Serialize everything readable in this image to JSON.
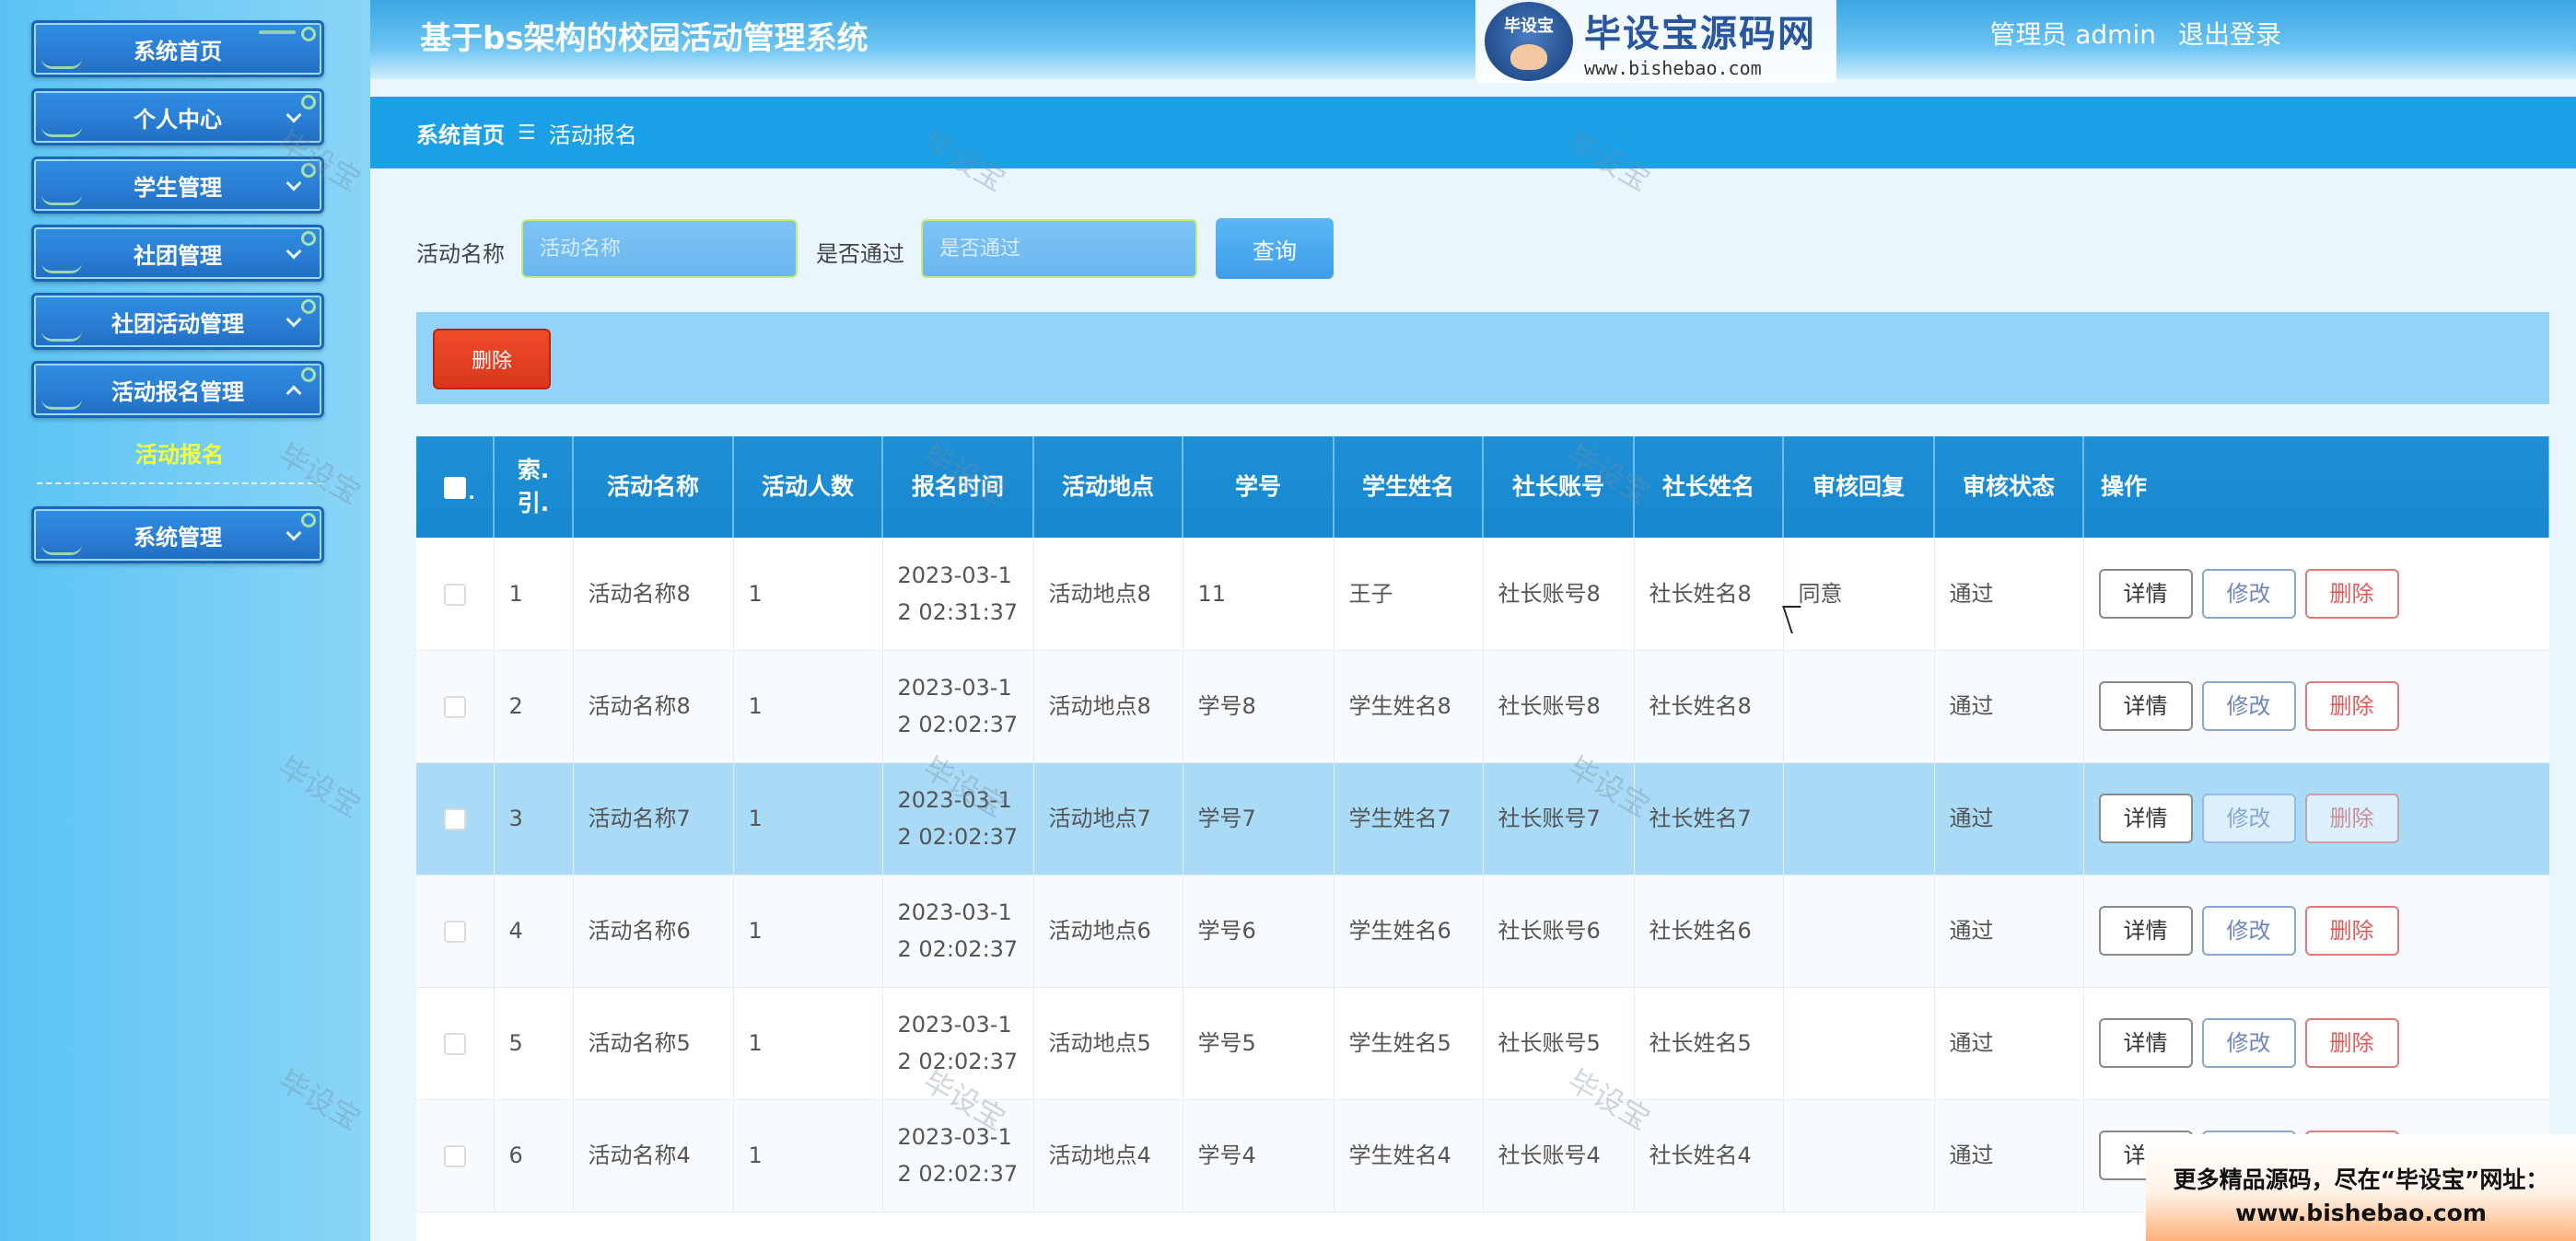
{
  "header": {
    "app_title": "基于bs架构的校园活动管理系统",
    "user_label": "管理员 admin",
    "logout": "退出登录",
    "logo_badge": "毕设宝",
    "logo_main": "毕设宝源码网",
    "logo_url": "www.bishebao.com"
  },
  "sidebar": {
    "items": [
      {
        "label": "系统首页"
      },
      {
        "label": "个人中心"
      },
      {
        "label": "学生管理"
      },
      {
        "label": "社团管理"
      },
      {
        "label": "社团活动管理"
      },
      {
        "label": "活动报名管理"
      },
      {
        "label": "系统管理"
      }
    ],
    "active_sub": "活动报名"
  },
  "breadcrumb": {
    "home": "系统首页",
    "sep": "☰",
    "current": "活动报名"
  },
  "search": {
    "name_label": "活动名称",
    "name_placeholder": "活动名称",
    "pass_label": "是否通过",
    "pass_placeholder": "是否通过",
    "query_button": "查询"
  },
  "actions": {
    "delete_batch": "删除"
  },
  "table": {
    "headers": [
      "索引",
      "活动名称",
      "活动人数",
      "报名时间",
      "活动地点",
      "学号",
      "学生姓名",
      "社长账号",
      "社长姓名",
      "审核回复",
      "审核状态",
      "操作"
    ],
    "index_header_line1": "索.",
    "index_header_line2": "引.",
    "buttons": {
      "detail": "详情",
      "edit": "修改",
      "delete": "删除"
    },
    "rows": [
      {
        "idx": "1",
        "name": "活动名称8",
        "count": "1",
        "time": "2023-03-12 02:31:37",
        "place": "活动地点8",
        "sno": "11",
        "sname": "王子",
        "leader_acc": "社长账号8",
        "leader_name": "社长姓名8",
        "reply": "同意",
        "status": "通过"
      },
      {
        "idx": "2",
        "name": "活动名称8",
        "count": "1",
        "time": "2023-03-12 02:02:37",
        "place": "活动地点8",
        "sno": "学号8",
        "sname": "学生姓名8",
        "leader_acc": "社长账号8",
        "leader_name": "社长姓名8",
        "reply": "",
        "status": "通过"
      },
      {
        "idx": "3",
        "name": "活动名称7",
        "count": "1",
        "time": "2023-03-12 02:02:37",
        "place": "活动地点7",
        "sno": "学号7",
        "sname": "学生姓名7",
        "leader_acc": "社长账号7",
        "leader_name": "社长姓名7",
        "reply": "",
        "status": "通过"
      },
      {
        "idx": "4",
        "name": "活动名称6",
        "count": "1",
        "time": "2023-03-12 02:02:37",
        "place": "活动地点6",
        "sno": "学号6",
        "sname": "学生姓名6",
        "leader_acc": "社长账号6",
        "leader_name": "社长姓名6",
        "reply": "",
        "status": "通过"
      },
      {
        "idx": "5",
        "name": "活动名称5",
        "count": "1",
        "time": "2023-03-12 02:02:37",
        "place": "活动地点5",
        "sno": "学号5",
        "sname": "学生姓名5",
        "leader_acc": "社长账号5",
        "leader_name": "社长姓名5",
        "reply": "",
        "status": "通过"
      },
      {
        "idx": "6",
        "name": "活动名称4",
        "count": "1",
        "time": "2023-03-12 02:02:37",
        "place": "活动地点4",
        "sno": "学号4",
        "sname": "学生姓名4",
        "leader_acc": "社长账号4",
        "leader_name": "社长姓名4",
        "reply": "",
        "status": "通过"
      }
    ]
  },
  "watermark": "毕设宝",
  "promo": {
    "line1": "更多精品源码，尽在“毕设宝”网址：",
    "line2": "www.bishebao.com"
  },
  "colors": {
    "primary": "#1aa0e6",
    "table_header": "#1788cf",
    "highlight_row": "#a9dbf7",
    "danger": "#e03a1f",
    "active_sub": "#f5ff3a"
  }
}
